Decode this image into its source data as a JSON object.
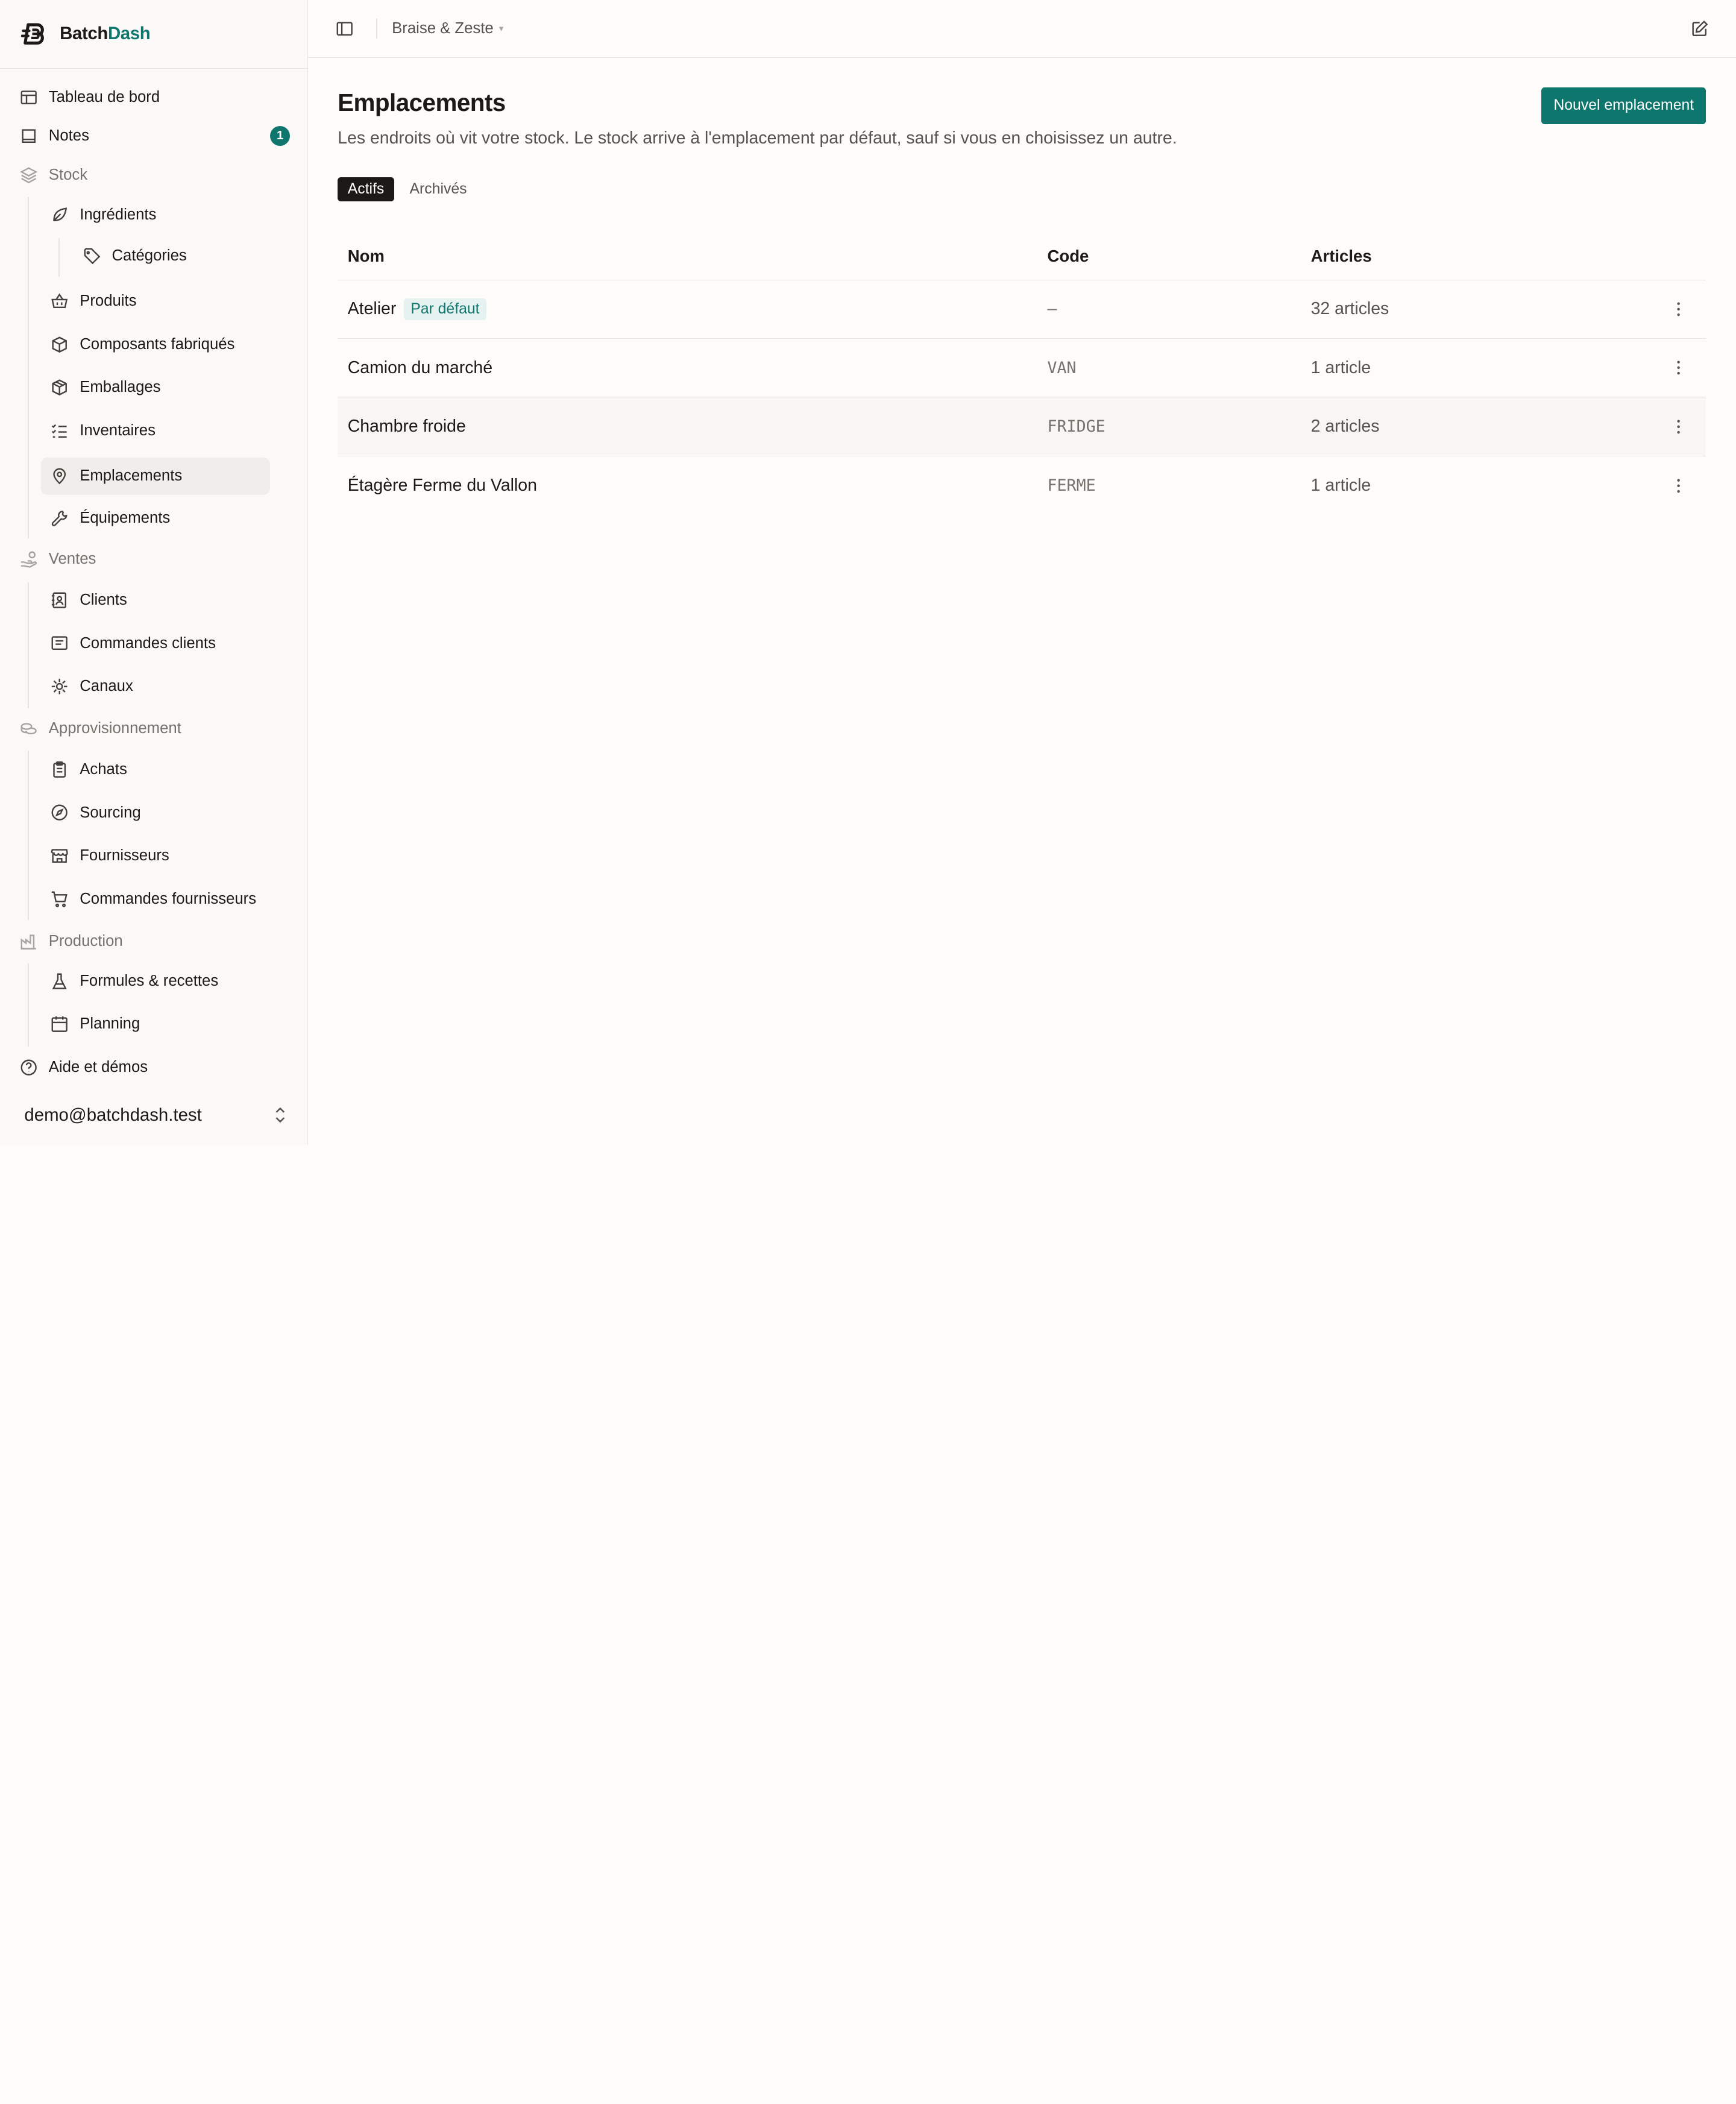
{
  "brand": {
    "name_part1": "Batch",
    "name_part2": "Dash"
  },
  "sidebar": {
    "items": [
      {
        "label": "Tableau de bord"
      },
      {
        "label": "Notes",
        "badge": "1"
      },
      {
        "label": "Stock"
      },
      {
        "label": "Ingrédients"
      },
      {
        "label": "Catégories"
      },
      {
        "label": "Produits"
      },
      {
        "label": "Composants fabriqués"
      },
      {
        "label": "Emballages"
      },
      {
        "label": "Inventaires"
      },
      {
        "label": "Emplacements"
      },
      {
        "label": "Équipements"
      },
      {
        "label": "Ventes"
      },
      {
        "label": "Clients"
      },
      {
        "label": "Commandes clients"
      },
      {
        "label": "Canaux"
      },
      {
        "label": "Approvisionnement"
      },
      {
        "label": "Achats"
      },
      {
        "label": "Sourcing"
      },
      {
        "label": "Fournisseurs"
      },
      {
        "label": "Commandes fournisseurs"
      },
      {
        "label": "Production"
      },
      {
        "label": "Formules & recettes"
      },
      {
        "label": "Planning"
      },
      {
        "label": "Aide et démos"
      }
    ],
    "account": "demo@batchdash.test"
  },
  "topbar": {
    "workspace": "Braise & Zeste",
    "caret": "▾"
  },
  "page": {
    "title": "Emplacements",
    "subtitle": "Les endroits où vit votre stock. Le stock arrive à l'emplacement par défaut, sauf si vous en choisissez un autre.",
    "new_button": "Nouvel emplacement",
    "tabs": [
      "Actifs",
      "Archivés"
    ]
  },
  "table": {
    "headers": [
      "Nom",
      "Code",
      "Articles"
    ],
    "rows": [
      {
        "name": "Atelier",
        "tag": "Par défaut",
        "code": "–",
        "articles": "32 articles"
      },
      {
        "name": "Camion du marché",
        "code": "VAN",
        "articles": "1 article"
      },
      {
        "name": "Chambre froide",
        "code": "FRIDGE",
        "articles": "2 articles"
      },
      {
        "name": "Étagère Ferme du Vallon",
        "code": "FERME",
        "articles": "1 article"
      }
    ]
  },
  "colors": {
    "accent": "#0f766e",
    "text": "#1c1917",
    "muted": "#57534e",
    "border": "#e7e5e4"
  }
}
